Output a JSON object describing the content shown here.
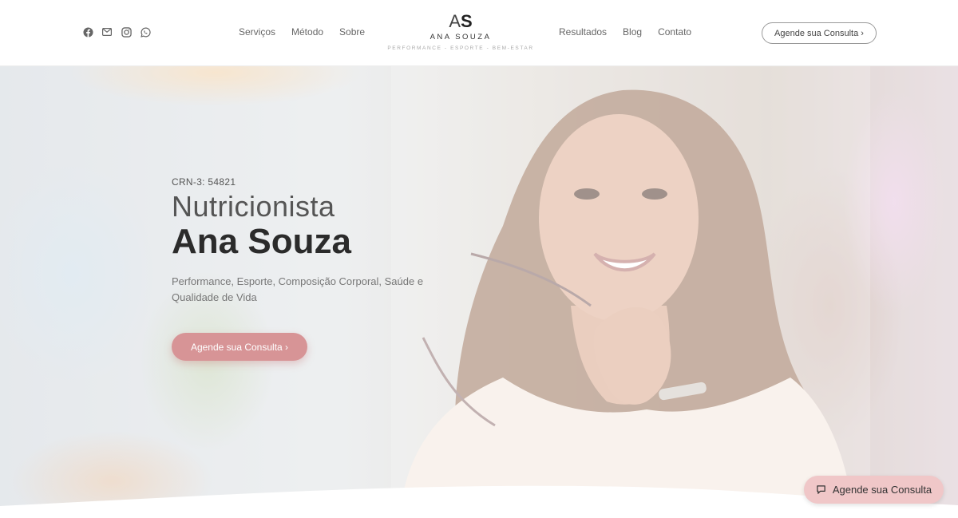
{
  "header": {
    "social_icons": [
      "facebook-icon",
      "email-icon",
      "instagram-icon",
      "whatsapp-icon"
    ],
    "nav_left": [
      {
        "label": "Serviços"
      },
      {
        "label": "Método"
      },
      {
        "label": "Sobre"
      }
    ],
    "logo": {
      "mark_a": "A",
      "mark_s": "S",
      "name": "ANA SOUZA",
      "tagline": "PERFORMANCE - ESPORTE - BEM-ESTAR"
    },
    "nav_right": [
      {
        "label": "Resultados"
      },
      {
        "label": "Blog"
      },
      {
        "label": "Contato"
      }
    ],
    "cta_label": "Agende sua Consulta ›"
  },
  "hero": {
    "crn": "CRN-3: 54821",
    "title_light": "Nutricionista",
    "title_bold": "Ana Souza",
    "subtitle": "Performance, Esporte, Composição Corporal, Saúde e Qualidade de Vida",
    "cta_label": "Agende sua Consulta ›"
  },
  "floating_cta": {
    "icon": "chat-icon",
    "label": "Agende sua Consulta"
  },
  "colors": {
    "accent_pink": "#d79496",
    "floating_pink": "#f0c7c8",
    "text_dark": "#2b2b2b"
  }
}
